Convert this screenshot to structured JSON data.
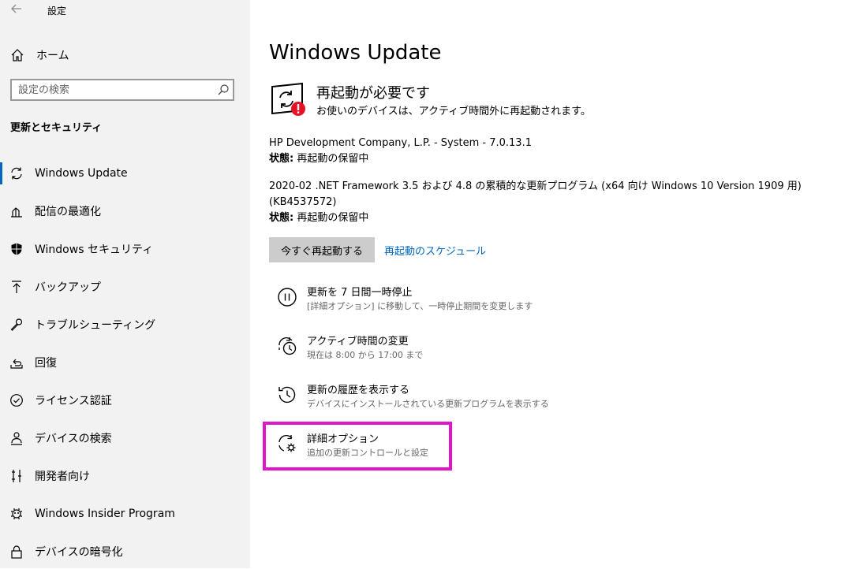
{
  "window": {
    "title": "設定",
    "back_icon": "back-arrow-icon"
  },
  "sidebar": {
    "home_label": "ホーム",
    "search_placeholder": "設定の検索",
    "section_title": "更新とセキュリティ",
    "items": [
      {
        "label": "Windows Update",
        "icon": "refresh-icon",
        "active": true
      },
      {
        "label": "配信の最適化",
        "icon": "delivery-optimization-icon"
      },
      {
        "label": "Windows セキュリティ",
        "icon": "shield-icon"
      },
      {
        "label": "バックアップ",
        "icon": "backup-arrow-icon"
      },
      {
        "label": "トラブルシューティング",
        "icon": "wrench-icon"
      },
      {
        "label": "回復",
        "icon": "recovery-icon"
      },
      {
        "label": "ライセンス認証",
        "icon": "check-circle-icon"
      },
      {
        "label": "デバイスの検索",
        "icon": "person-pin-icon"
      },
      {
        "label": "開発者向け",
        "icon": "developer-icon"
      },
      {
        "label": "Windows Insider Program",
        "icon": "insider-icon"
      },
      {
        "label": "デバイスの暗号化",
        "icon": "lock-icon"
      }
    ]
  },
  "main": {
    "title": "Windows Update",
    "status": {
      "title": "再起動が必要です",
      "subtitle": "お使いのデバイスは、アクティブ時間外に再起動されます。"
    },
    "updates": [
      {
        "name": "HP Development Company, L.P. - System - 7.0.13.1",
        "state_label": "状態:",
        "state_value": " 再起動の保留中"
      },
      {
        "name": "2020-02 .NET Framework 3.5 および 4.8 の累積的な更新プログラム (x64 向け Windows 10 Version 1909 用)",
        "name2": "(KB4537572)",
        "state_label": "状態:",
        "state_value": " 再起動の保留中"
      }
    ],
    "restart_now_button": "今すぐ再起動する",
    "schedule_link": "再起動のスケジュール",
    "options": [
      {
        "title": "更新を 7 日間一時停止",
        "subtitle": "[詳細オプション] に移動して、一時停止期間を変更します",
        "icon": "pause-icon"
      },
      {
        "title": "アクティブ時間の変更",
        "subtitle": "現在は 8:00 から 17:00 まで",
        "icon": "active-hours-clock-icon"
      },
      {
        "title": "更新の履歴を表示する",
        "subtitle": "デバイスにインストールされている更新プログラムを表示する",
        "icon": "history-icon"
      },
      {
        "title": "詳細オプション",
        "subtitle": "追加の更新コントロールと設定",
        "icon": "advanced-options-icon"
      }
    ],
    "highlight_color": "#e016c8",
    "accent_color": "#0067c0",
    "error_color": "#e81123"
  }
}
